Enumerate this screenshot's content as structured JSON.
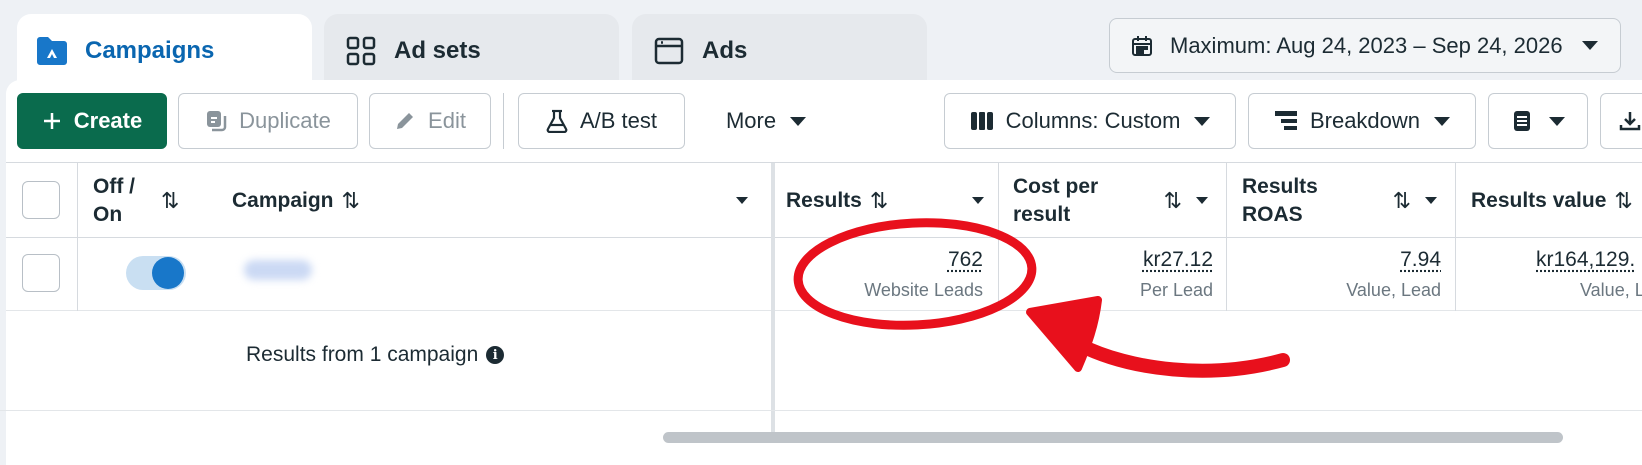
{
  "tabs": [
    {
      "label": "Campaigns",
      "icon": "campaign-folder-icon",
      "active": true
    },
    {
      "label": "Ad sets",
      "icon": "grid-icon"
    },
    {
      "label": "Ads",
      "icon": "ad-window-icon"
    }
  ],
  "date_range": {
    "label": "Maximum: Aug 24, 2023 – Sep 24, 2026",
    "icon": "calendar-icon"
  },
  "toolbar": {
    "create": "Create",
    "duplicate": "Duplicate",
    "edit": "Edit",
    "ab_test": "A/B test",
    "more": "More",
    "columns": "Columns: Custom",
    "breakdown": "Breakdown"
  },
  "table": {
    "headers": {
      "off_on": "Off / On",
      "campaign": "Campaign",
      "results": "Results",
      "cost_per_result": "Cost per result",
      "results_roas": "Results ROAS",
      "results_value": "Results value"
    },
    "row": {
      "toggle_on": true,
      "results": "762",
      "results_sub": "Website Leads",
      "cost": "kr27.12",
      "cost_sub": "Per Lead",
      "roas": "7.94",
      "roas_sub": "Value, Lead",
      "value": "kr164,129.",
      "value_sub": "Value, L"
    },
    "summary": "Results from 1 campaign"
  },
  "colors": {
    "accent_blue": "#0a66b0",
    "create_green": "#0a6b4d",
    "annotation_red": "#e8101c"
  }
}
